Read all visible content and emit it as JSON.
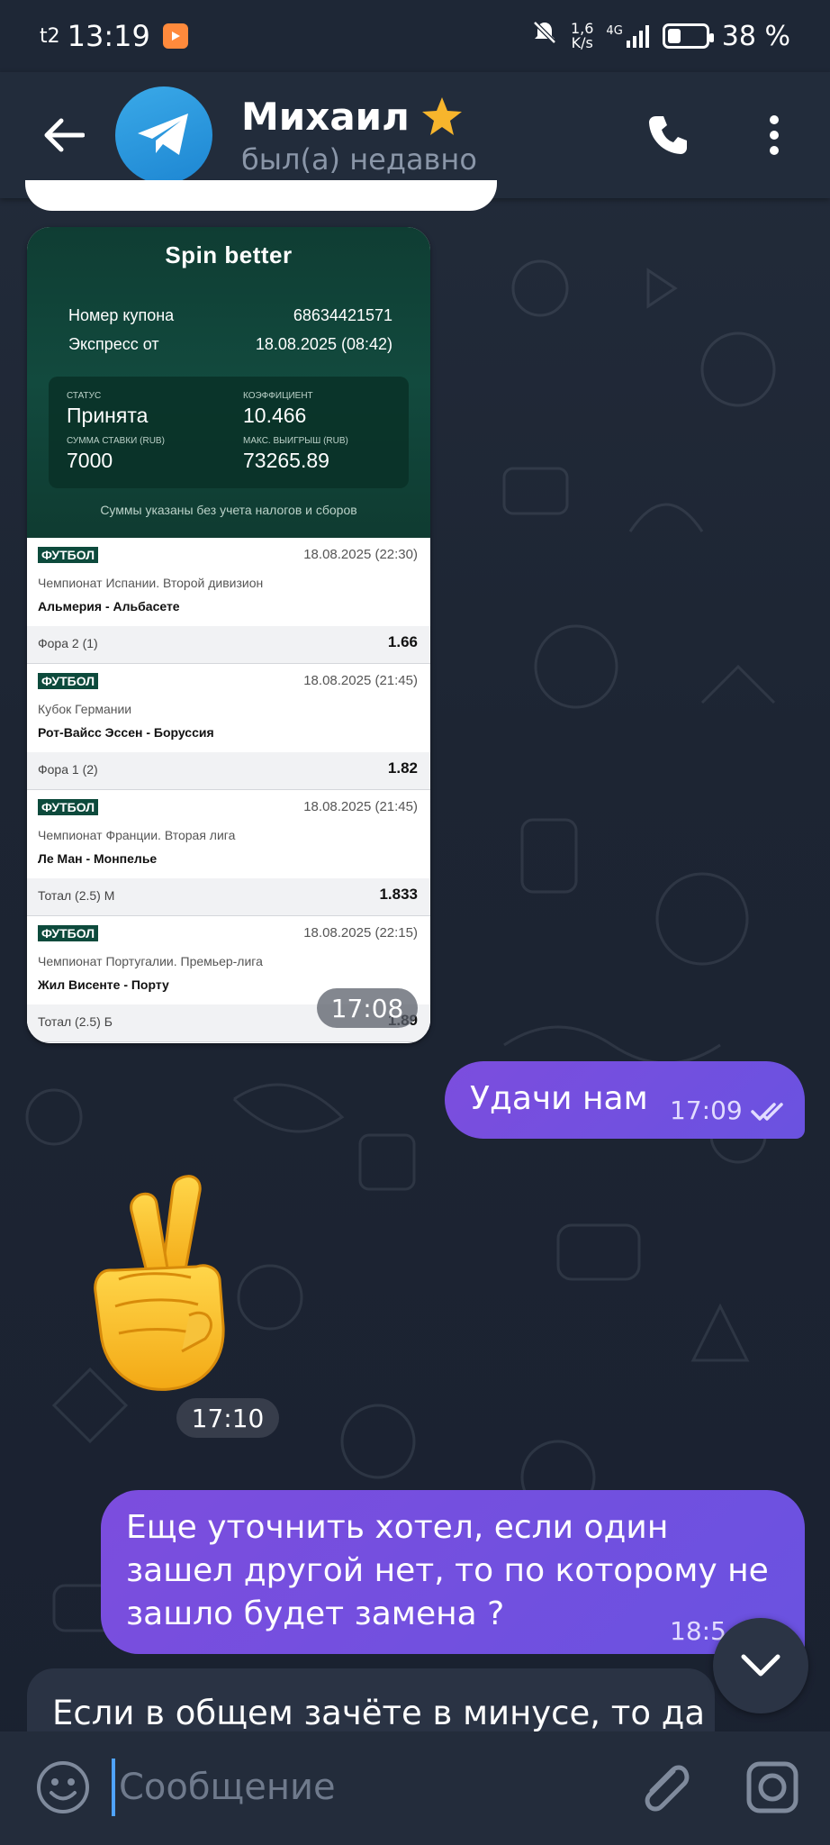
{
  "status_bar": {
    "carrier": "t2",
    "time": "13:19",
    "net_speed_value": "1,6",
    "net_speed_unit": "K/s",
    "network": "4G",
    "battery": "38 %",
    "battery_level": 0.38
  },
  "header": {
    "contact_name": "Михаил",
    "contact_status": "был(а) недавно"
  },
  "coupon": {
    "brand": "Spin better",
    "coupon_number_label": "Номер купона",
    "coupon_number": "68634421571",
    "express_label": "Экспресс от",
    "express_date": "18.08.2025 (08:42)",
    "status_label": "СТАТУС",
    "status_value": "Принята",
    "coef_label": "КОЭФФИЦИЕНТ",
    "coef_value": "10.466",
    "stake_label": "СУММА СТАВКИ (RUB)",
    "stake_value": "7000",
    "max_win_label": "МАКС. ВЫИГРЫШ (RUB)",
    "max_win_value": "73265.89",
    "note": "Суммы указаны без учета налогов и сборов",
    "bets": [
      {
        "sport": "ФУТБОЛ",
        "date": "18.08.2025 (22:30)",
        "league": "Чемпионат Испании. Второй дивизион",
        "match": "Альмерия - Альбасете",
        "type": "Фора 2 (1)",
        "odds": "1.66"
      },
      {
        "sport": "ФУТБОЛ",
        "date": "18.08.2025 (21:45)",
        "league": "Кубок Германии",
        "match": "Рот-Вайсс Эссен - Боруссия",
        "type": "Фора 1 (2)",
        "odds": "1.82"
      },
      {
        "sport": "ФУТБОЛ",
        "date": "18.08.2025 (21:45)",
        "league": "Чемпионат Франции. Вторая лига",
        "match": "Ле Ман - Монпелье",
        "type": "Тотал (2.5) М",
        "odds": "1.833"
      },
      {
        "sport": "ФУТБОЛ",
        "date": "18.08.2025 (22:15)",
        "league": "Чемпионат Португалии. Премьер-лига",
        "match": "Жил Висенте - Порту",
        "type": "Тотал (2.5) Б",
        "odds": "1.89"
      }
    ],
    "time": "17:08"
  },
  "messages": {
    "out1_text": "Удачи нам",
    "out1_time": "17:09",
    "sticker_time": "17:10",
    "out2_line1": "Еще уточнить хотел, если один",
    "out2_line2": "зашел другой нет, то по которому не",
    "out2_line3": "зашло будет замена ?",
    "out2_time": "18:5",
    "in1_text": "Если в общем зачёте в минусе, то да"
  },
  "composer": {
    "placeholder": "Сообщение"
  },
  "colors": {
    "outgoing_bubble": "#7c4dde",
    "header_bg": "#222c3b",
    "coupon_green": "#124a3e"
  },
  "icons": [
    "back-arrow-icon",
    "telegram-plane-icon",
    "star-icon",
    "phone-icon",
    "more-vertical-icon",
    "emoji-icon",
    "paperclip-icon",
    "camera-icon",
    "chevron-down-icon",
    "double-check-icon",
    "mute-bell-icon",
    "signal-icon",
    "battery-icon"
  ]
}
